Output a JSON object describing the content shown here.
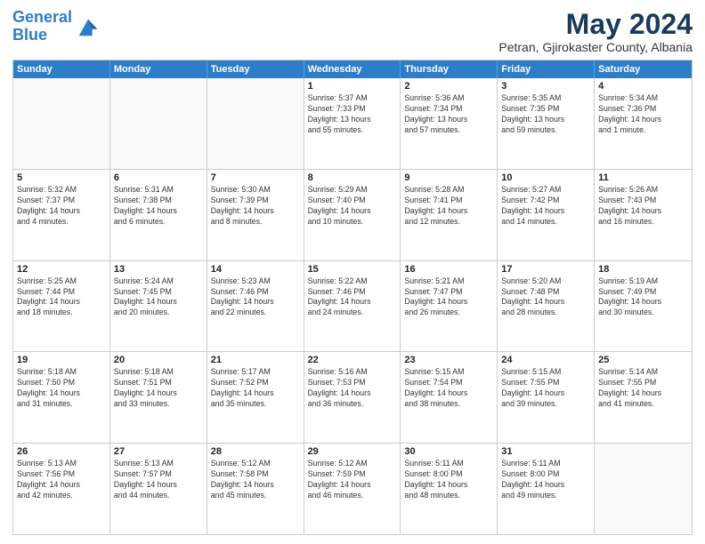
{
  "header": {
    "logo_line1": "General",
    "logo_line2": "Blue",
    "month": "May 2024",
    "location": "Petran, Gjirokaster County, Albania"
  },
  "weekdays": [
    "Sunday",
    "Monday",
    "Tuesday",
    "Wednesday",
    "Thursday",
    "Friday",
    "Saturday"
  ],
  "rows": [
    [
      {
        "day": "",
        "text": ""
      },
      {
        "day": "",
        "text": ""
      },
      {
        "day": "",
        "text": ""
      },
      {
        "day": "1",
        "text": "Sunrise: 5:37 AM\nSunset: 7:33 PM\nDaylight: 13 hours\nand 55 minutes."
      },
      {
        "day": "2",
        "text": "Sunrise: 5:36 AM\nSunset: 7:34 PM\nDaylight: 13 hours\nand 57 minutes."
      },
      {
        "day": "3",
        "text": "Sunrise: 5:35 AM\nSunset: 7:35 PM\nDaylight: 13 hours\nand 59 minutes."
      },
      {
        "day": "4",
        "text": "Sunrise: 5:34 AM\nSunset: 7:36 PM\nDaylight: 14 hours\nand 1 minute."
      }
    ],
    [
      {
        "day": "5",
        "text": "Sunrise: 5:32 AM\nSunset: 7:37 PM\nDaylight: 14 hours\nand 4 minutes."
      },
      {
        "day": "6",
        "text": "Sunrise: 5:31 AM\nSunset: 7:38 PM\nDaylight: 14 hours\nand 6 minutes."
      },
      {
        "day": "7",
        "text": "Sunrise: 5:30 AM\nSunset: 7:39 PM\nDaylight: 14 hours\nand 8 minutes."
      },
      {
        "day": "8",
        "text": "Sunrise: 5:29 AM\nSunset: 7:40 PM\nDaylight: 14 hours\nand 10 minutes."
      },
      {
        "day": "9",
        "text": "Sunrise: 5:28 AM\nSunset: 7:41 PM\nDaylight: 14 hours\nand 12 minutes."
      },
      {
        "day": "10",
        "text": "Sunrise: 5:27 AM\nSunset: 7:42 PM\nDaylight: 14 hours\nand 14 minutes."
      },
      {
        "day": "11",
        "text": "Sunrise: 5:26 AM\nSunset: 7:43 PM\nDaylight: 14 hours\nand 16 minutes."
      }
    ],
    [
      {
        "day": "12",
        "text": "Sunrise: 5:25 AM\nSunset: 7:44 PM\nDaylight: 14 hours\nand 18 minutes."
      },
      {
        "day": "13",
        "text": "Sunrise: 5:24 AM\nSunset: 7:45 PM\nDaylight: 14 hours\nand 20 minutes."
      },
      {
        "day": "14",
        "text": "Sunrise: 5:23 AM\nSunset: 7:46 PM\nDaylight: 14 hours\nand 22 minutes."
      },
      {
        "day": "15",
        "text": "Sunrise: 5:22 AM\nSunset: 7:46 PM\nDaylight: 14 hours\nand 24 minutes."
      },
      {
        "day": "16",
        "text": "Sunrise: 5:21 AM\nSunset: 7:47 PM\nDaylight: 14 hours\nand 26 minutes."
      },
      {
        "day": "17",
        "text": "Sunrise: 5:20 AM\nSunset: 7:48 PM\nDaylight: 14 hours\nand 28 minutes."
      },
      {
        "day": "18",
        "text": "Sunrise: 5:19 AM\nSunset: 7:49 PM\nDaylight: 14 hours\nand 30 minutes."
      }
    ],
    [
      {
        "day": "19",
        "text": "Sunrise: 5:18 AM\nSunset: 7:50 PM\nDaylight: 14 hours\nand 31 minutes."
      },
      {
        "day": "20",
        "text": "Sunrise: 5:18 AM\nSunset: 7:51 PM\nDaylight: 14 hours\nand 33 minutes."
      },
      {
        "day": "21",
        "text": "Sunrise: 5:17 AM\nSunset: 7:52 PM\nDaylight: 14 hours\nand 35 minutes."
      },
      {
        "day": "22",
        "text": "Sunrise: 5:16 AM\nSunset: 7:53 PM\nDaylight: 14 hours\nand 36 minutes."
      },
      {
        "day": "23",
        "text": "Sunrise: 5:15 AM\nSunset: 7:54 PM\nDaylight: 14 hours\nand 38 minutes."
      },
      {
        "day": "24",
        "text": "Sunrise: 5:15 AM\nSunset: 7:55 PM\nDaylight: 14 hours\nand 39 minutes."
      },
      {
        "day": "25",
        "text": "Sunrise: 5:14 AM\nSunset: 7:55 PM\nDaylight: 14 hours\nand 41 minutes."
      }
    ],
    [
      {
        "day": "26",
        "text": "Sunrise: 5:13 AM\nSunset: 7:56 PM\nDaylight: 14 hours\nand 42 minutes."
      },
      {
        "day": "27",
        "text": "Sunrise: 5:13 AM\nSunset: 7:57 PM\nDaylight: 14 hours\nand 44 minutes."
      },
      {
        "day": "28",
        "text": "Sunrise: 5:12 AM\nSunset: 7:58 PM\nDaylight: 14 hours\nand 45 minutes."
      },
      {
        "day": "29",
        "text": "Sunrise: 5:12 AM\nSunset: 7:59 PM\nDaylight: 14 hours\nand 46 minutes."
      },
      {
        "day": "30",
        "text": "Sunrise: 5:11 AM\nSunset: 8:00 PM\nDaylight: 14 hours\nand 48 minutes."
      },
      {
        "day": "31",
        "text": "Sunrise: 5:11 AM\nSunset: 8:00 PM\nDaylight: 14 hours\nand 49 minutes."
      },
      {
        "day": "",
        "text": ""
      }
    ]
  ]
}
